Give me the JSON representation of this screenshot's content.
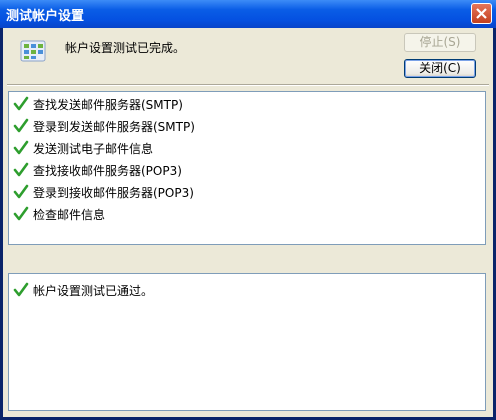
{
  "window": {
    "title": "测试帐户设置"
  },
  "header": {
    "status": "帐户设置测试已完成。",
    "stop_label": "停止(S)",
    "close_label": "关闭(C)"
  },
  "tasks": [
    "查找发送邮件服务器(SMTP)",
    "登录到发送邮件服务器(SMTP)",
    "发送测试电子邮件信息",
    "查找接收邮件服务器(POP3)",
    "登录到接收邮件服务器(POP3)",
    "检查邮件信息"
  ],
  "results": [
    "帐户设置测试已通过。"
  ],
  "colors": {
    "check": "#2e9e2e",
    "titlebar": "#0551e1"
  },
  "icons": {
    "check": "check-icon",
    "app": "account-settings-icon",
    "close": "close-icon"
  }
}
